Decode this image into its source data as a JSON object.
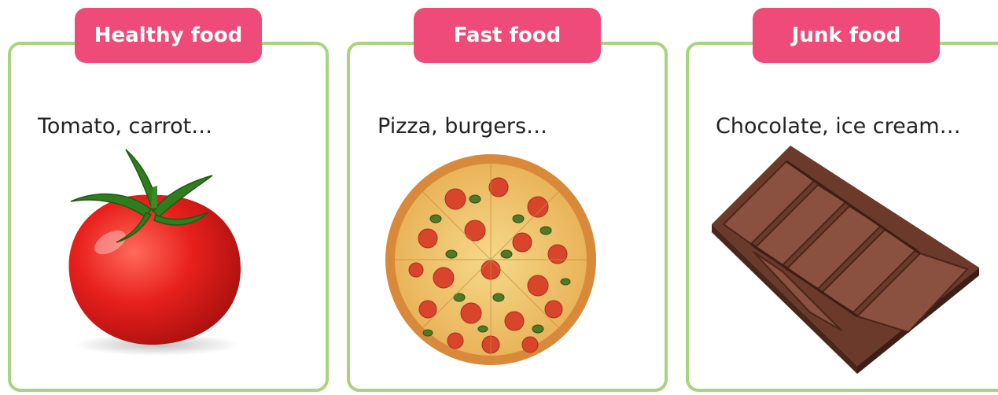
{
  "cards": [
    {
      "heading": "Healthy food",
      "examples": "Tomato, carrot…",
      "picture": "tomato-image"
    },
    {
      "heading": "Fast food",
      "examples": "Pizza, burgers…",
      "picture": "pizza-image"
    },
    {
      "heading": "Junk food",
      "examples": "Chocolate, ice cream…",
      "picture": "chocolate-bar-image"
    }
  ],
  "colors": {
    "card_border": "#a9d37e",
    "heading_background": "#ef4b78",
    "heading_text": "#ffffff"
  }
}
